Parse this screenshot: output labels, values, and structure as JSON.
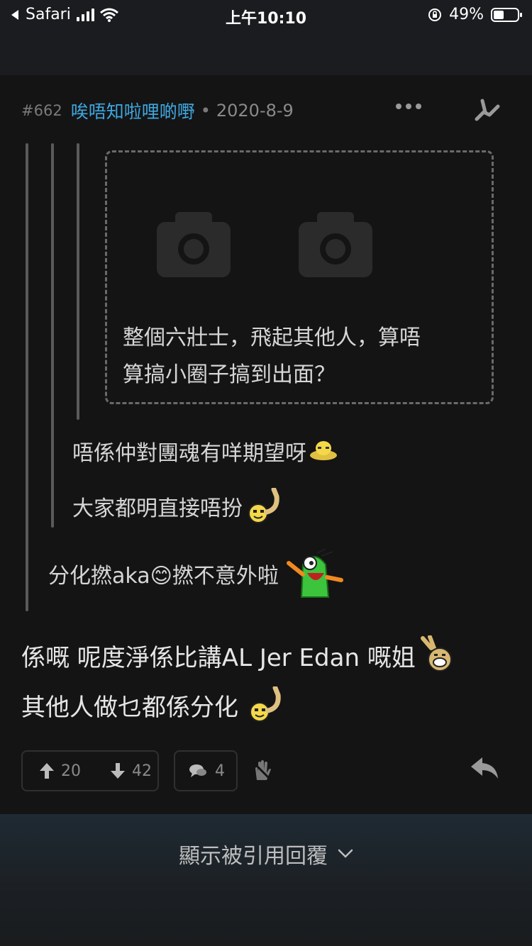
{
  "status_bar": {
    "back_app": "Safari",
    "time": "上午10:10",
    "battery": "49%",
    "battery_level": 0.49
  },
  "post": {
    "number": "#662",
    "username": "唉唔知啦哩啲嘢",
    "separator": "•",
    "date": "2020-8-9",
    "quotes": {
      "nested_image_quote": {
        "images": [
          "camera-placeholder-icon",
          "camera-placeholder-icon"
        ],
        "text_line1": "整個六壯士，飛起其他人，算唔",
        "text_line2": "算搞小圈子搞到出面？"
      },
      "level2_line1": "唔係仲對團魂有咩期望呀",
      "level2_line2": "大家都明直接唔扮",
      "level1_line1": "分化撚aka😊撚不意外啦"
    },
    "body_line1": "係嘅 呢度淨係比講AL Jer Edan 嘅姐",
    "body_line2": "其他人做乜都係分化"
  },
  "actions": {
    "upvotes": "20",
    "downvotes": "42",
    "comments": "4"
  },
  "footer": {
    "show_quoted_label": "顯示被引用回覆"
  },
  "colors": {
    "username": "#3ea7e0",
    "background": "#141414"
  }
}
